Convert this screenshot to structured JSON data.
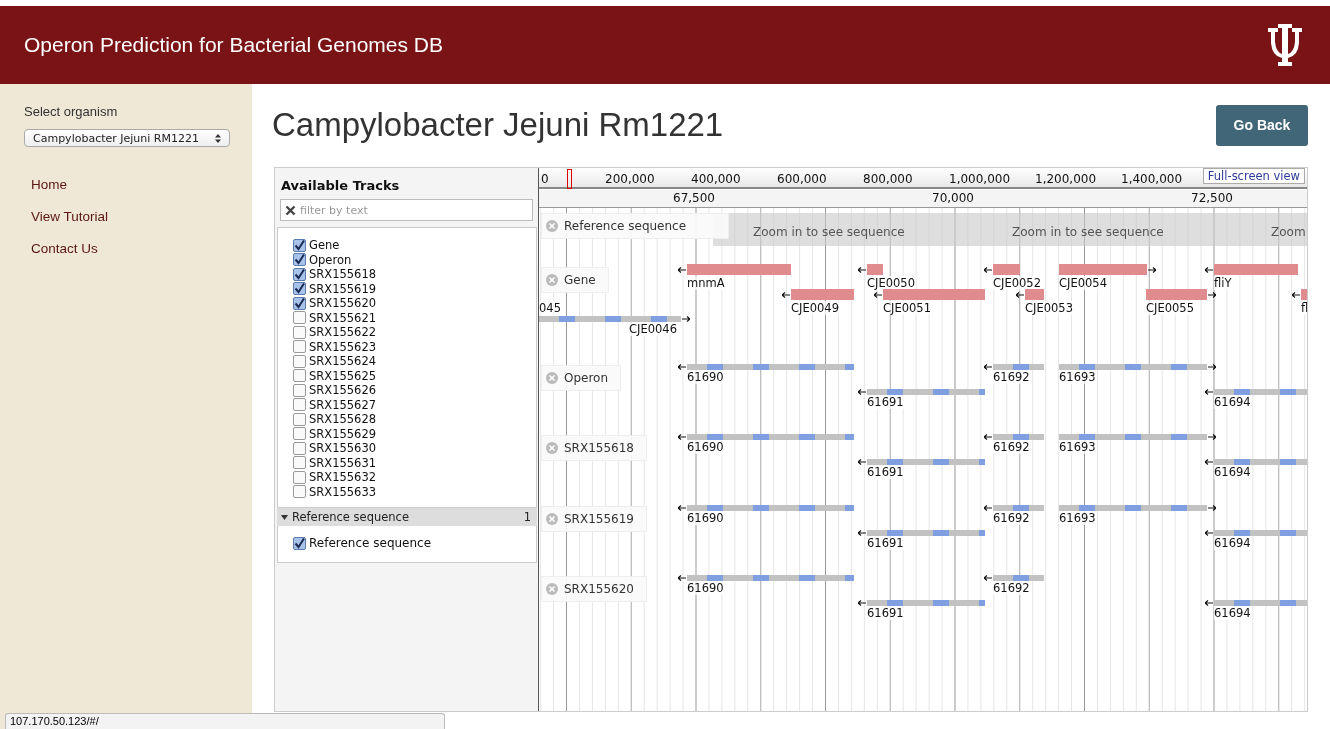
{
  "header": {
    "title": "Operon Prediction for Bacterial Genomes DB"
  },
  "sidebar": {
    "select_label": "Select organism",
    "organism": "Campylobacter Jejuni RM1221",
    "links": [
      {
        "label": "Home"
      },
      {
        "label": "View Tutorial"
      },
      {
        "label": "Contact Us"
      }
    ]
  },
  "page": {
    "title": "Campylobacter Jejuni Rm1221",
    "back_button": "Go Back"
  },
  "track_selector": {
    "title": "Available Tracks",
    "filter_placeholder": "filter by text",
    "tracks": [
      {
        "label": "Gene",
        "checked": true
      },
      {
        "label": "Operon",
        "checked": true
      },
      {
        "label": "SRX155618",
        "checked": true
      },
      {
        "label": "SRX155619",
        "checked": true
      },
      {
        "label": "SRX155620",
        "checked": true
      },
      {
        "label": "SRX155621",
        "checked": false
      },
      {
        "label": "SRX155622",
        "checked": false
      },
      {
        "label": "SRX155623",
        "checked": false
      },
      {
        "label": "SRX155624",
        "checked": false
      },
      {
        "label": "SRX155625",
        "checked": false
      },
      {
        "label": "SRX155626",
        "checked": false
      },
      {
        "label": "SRX155627",
        "checked": false
      },
      {
        "label": "SRX155628",
        "checked": false
      },
      {
        "label": "SRX155629",
        "checked": false
      },
      {
        "label": "SRX155630",
        "checked": false
      },
      {
        "label": "SRX155631",
        "checked": false
      },
      {
        "label": "SRX155632",
        "checked": false
      },
      {
        "label": "SRX155633",
        "checked": false
      }
    ],
    "category": {
      "label": "Reference sequence",
      "count": "1",
      "expanded": true,
      "tracks": [
        {
          "label": "Reference sequence",
          "checked": true
        }
      ]
    }
  },
  "overview": {
    "ticks": [
      "0",
      "200,000",
      "400,000",
      "600,000",
      "800,000",
      "1,000,000",
      "1,200,000",
      "1,400,000"
    ]
  },
  "full_screen_link": "Full-screen view",
  "ruler": {
    "ticks": [
      "67,500",
      "70,000",
      "72,500"
    ]
  },
  "reference_track": {
    "label": "Reference sequence",
    "messages": [
      "Zoom in to see sequence",
      "Zoom in to see sequence",
      "Zoom"
    ]
  },
  "tracks": [
    {
      "label": "Gene",
      "features": [
        {
          "name": "mnmA",
          "reverse": true,
          "kind": "gene"
        },
        {
          "name": "CJE0050",
          "reverse": true,
          "kind": "gene"
        },
        {
          "name": "CJE0052",
          "reverse": true,
          "kind": "gene"
        },
        {
          "name": "CJE0054",
          "reverse": false,
          "kind": "gene"
        },
        {
          "name": "fliY",
          "reverse": true,
          "kind": "gene"
        },
        {
          "name": "045",
          "kind": "gene"
        },
        {
          "name": "CJE0049",
          "reverse": true,
          "kind": "gene"
        },
        {
          "name": "CJE0051",
          "reverse": true,
          "kind": "gene"
        },
        {
          "name": "CJE0053",
          "reverse": true,
          "kind": "gene"
        },
        {
          "name": "CJE0055",
          "reverse": false,
          "kind": "gene"
        },
        {
          "name": "fl",
          "reverse": true,
          "kind": "gene"
        },
        {
          "name": "CJE0046",
          "reverse": false,
          "kind": "operon"
        }
      ]
    },
    {
      "label": "Operon",
      "features": [
        {
          "name": "61690",
          "reverse": true,
          "kind": "operon"
        },
        {
          "name": "61692",
          "reverse": true,
          "kind": "operon"
        },
        {
          "name": "61693",
          "reverse": false,
          "kind": "operon"
        },
        {
          "name": "61691",
          "reverse": true,
          "kind": "operon"
        },
        {
          "name": "61694",
          "reverse": true,
          "kind": "operon"
        }
      ]
    },
    {
      "label": "SRX155618",
      "features": [
        {
          "name": "61690",
          "reverse": true,
          "kind": "operon"
        },
        {
          "name": "61692",
          "reverse": true,
          "kind": "operon"
        },
        {
          "name": "61693",
          "reverse": false,
          "kind": "operon"
        },
        {
          "name": "61691",
          "reverse": true,
          "kind": "operon"
        },
        {
          "name": "61694",
          "reverse": true,
          "kind": "operon"
        }
      ]
    },
    {
      "label": "SRX155619",
      "features": [
        {
          "name": "61690",
          "reverse": true,
          "kind": "operon"
        },
        {
          "name": "61692",
          "reverse": true,
          "kind": "operon"
        },
        {
          "name": "61693",
          "reverse": false,
          "kind": "operon"
        },
        {
          "name": "61691",
          "reverse": true,
          "kind": "operon"
        },
        {
          "name": "61694",
          "reverse": true,
          "kind": "operon"
        }
      ]
    },
    {
      "label": "SRX155620",
      "features": [
        {
          "name": "61690",
          "reverse": true,
          "kind": "operon"
        },
        {
          "name": "61692",
          "reverse": true,
          "kind": "operon"
        },
        {
          "name": "61691",
          "reverse": true,
          "kind": "operon"
        },
        {
          "name": "61694",
          "reverse": true,
          "kind": "operon"
        }
      ]
    }
  ],
  "status_bar": "107.170.50.123/#/"
}
